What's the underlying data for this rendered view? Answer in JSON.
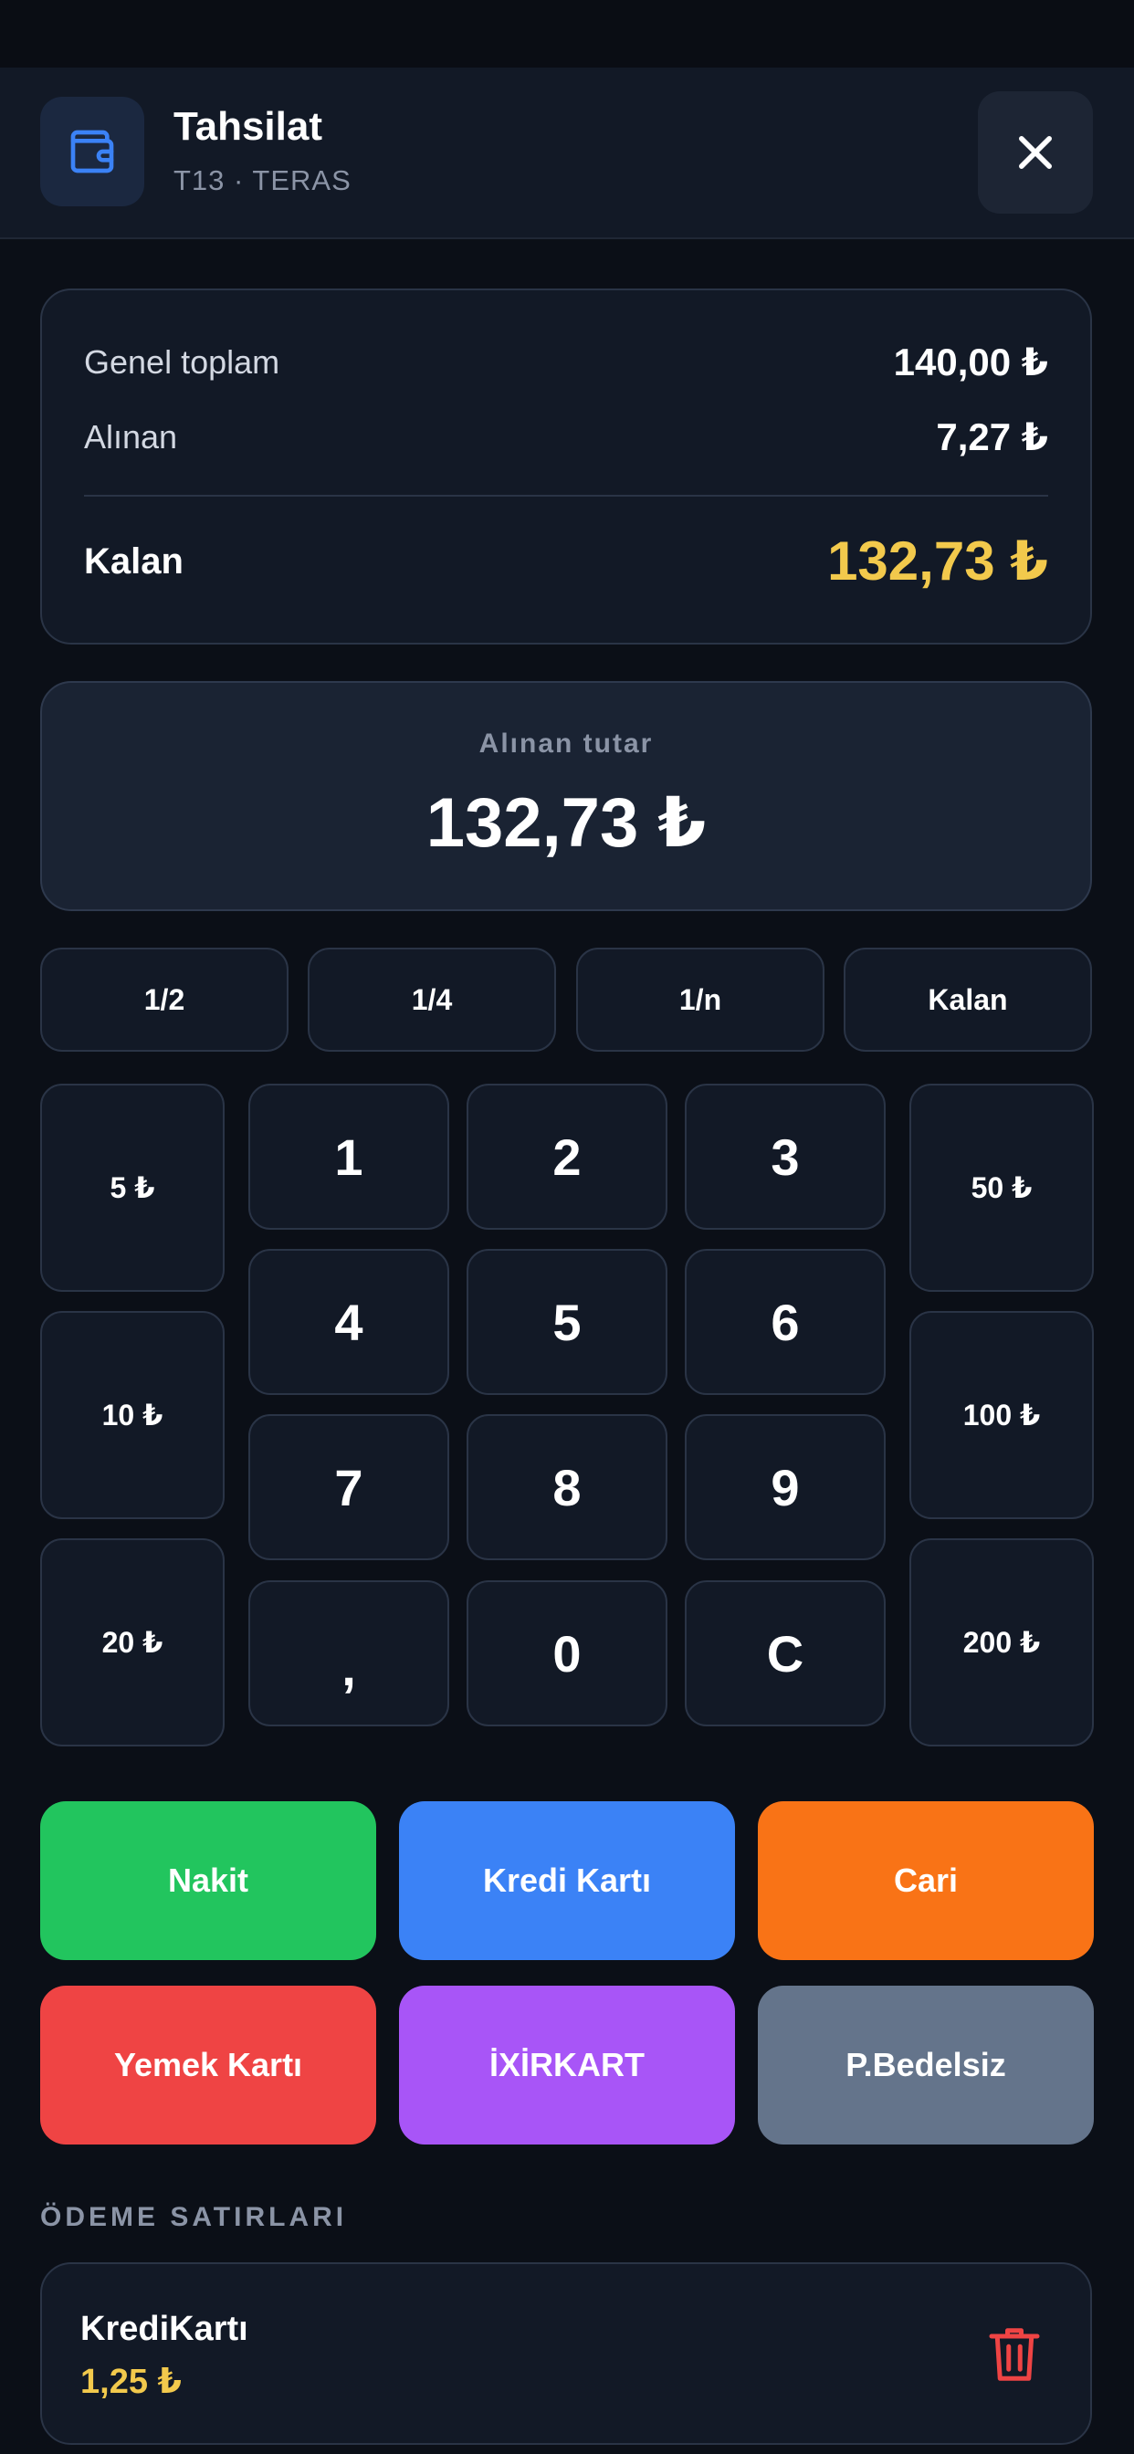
{
  "header": {
    "title": "Tahsilat",
    "subtitle": "T13 · TERAS",
    "icon": "wallet-icon",
    "close_icon": "close-icon"
  },
  "summary": {
    "grand_total_label": "Genel toplam",
    "grand_total_value": "140,00 ₺",
    "received_label": "Alınan",
    "received_value": "7,27 ₺",
    "remaining_label": "Kalan",
    "remaining_value": "132,73 ₺"
  },
  "amount": {
    "label": "Alınan tutar",
    "value": "132,73 ₺"
  },
  "split_keys": [
    "1/2",
    "1/4",
    "1/n",
    "Kalan"
  ],
  "quick_left": [
    "5 ₺",
    "10 ₺",
    "20 ₺"
  ],
  "quick_right": [
    "50 ₺",
    "100 ₺",
    "200 ₺"
  ],
  "numpad": [
    "1",
    "2",
    "3",
    "4",
    "5",
    "6",
    "7",
    "8",
    "9",
    ",",
    "0",
    "C"
  ],
  "payment_methods": [
    {
      "label": "Nakit",
      "color": "#22c55e"
    },
    {
      "label": "Kredi Kartı",
      "color": "#3b82f6"
    },
    {
      "label": "Cari",
      "color": "#f97316"
    },
    {
      "label": "Yemek Kartı",
      "color": "#ef4444"
    },
    {
      "label": "İXİRKART",
      "color": "#a855f7"
    },
    {
      "label": "P.Bedelsiz",
      "color": "#64748b"
    }
  ],
  "payment_lines": {
    "heading": "ÖDEME SATIRLARI",
    "items": [
      {
        "name": "KrediKartı",
        "amount": "1,25 ₺",
        "delete_icon": "trash-icon"
      }
    ]
  },
  "colors": {
    "accent_yellow": "#f2c94c",
    "accent_blue": "#3b82f6",
    "delete_red": "#ef4444"
  }
}
